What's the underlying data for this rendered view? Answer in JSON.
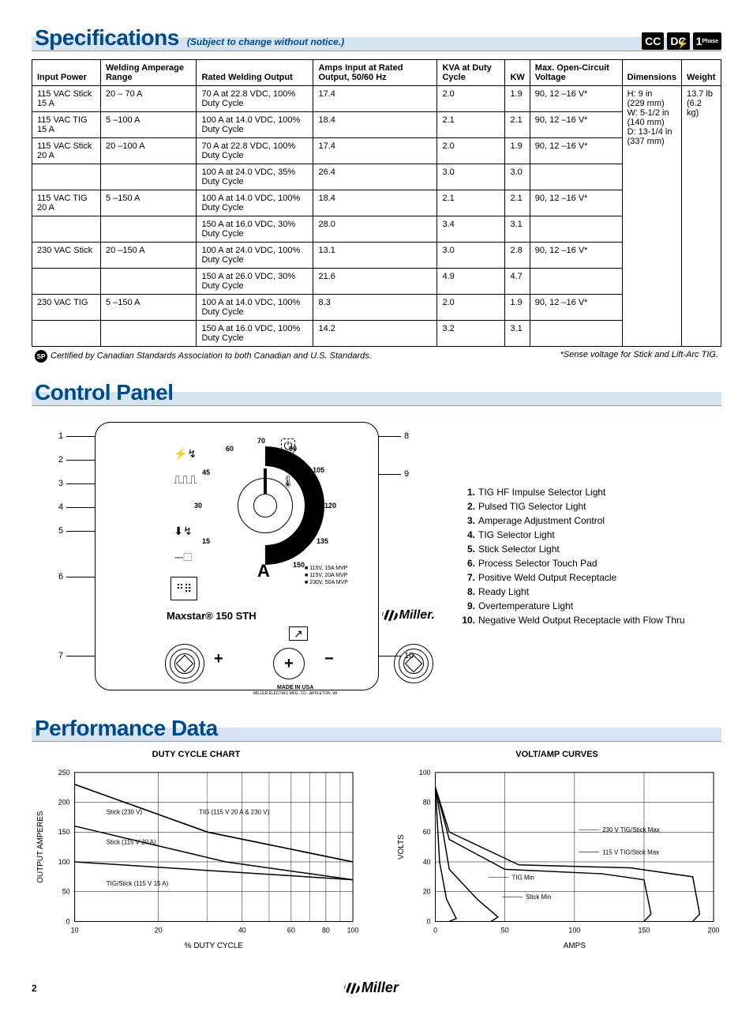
{
  "sections": {
    "specifications": {
      "title": "Specifications",
      "subtitle": "(Subject to change without notice.)"
    },
    "control_panel": {
      "title": "Control Panel"
    },
    "performance": {
      "title": "Performance Data"
    }
  },
  "badges": {
    "cc": "CC",
    "dc": "DC",
    "phase_num": "1",
    "phase_label": "Phase"
  },
  "spec_table": {
    "headers": {
      "input_power": "Input Power",
      "welding_range": "Welding Amperage Range",
      "rated_output": "Rated Welding Output",
      "amps_input": "Amps Input at Rated Output, 50/60 Hz",
      "kva": "KVA at Duty Cycle",
      "kw": "KW",
      "max_ocv": "Max. Open-Circuit Voltage",
      "dimensions": "Dimensions",
      "weight": "Weight"
    },
    "dimensions_text": "H: 9 in\n(229 mm)\nW: 5-1/2 in\n(140 mm)\nD: 13-1/4 in\n(337 mm)",
    "weight_text": "13.7 lb\n(6.2 kg)",
    "rows": [
      {
        "ip": "115 VAC Stick 15 A",
        "wr": "20 – 70 A",
        "ro": "70 A at 22.8 VDC, 100% Duty Cycle",
        "ai": "17.4",
        "kva": "2.0",
        "kw": "1.9",
        "ocv": "90, 12 –16 V*"
      },
      {
        "ip": "115 VAC TIG 15 A",
        "wr": "5 –100 A",
        "ro": "100 A at 14.0 VDC, 100% Duty Cycle",
        "ai": "18.4",
        "kva": "2.1",
        "kw": "2.1",
        "ocv": "90, 12 –16 V*"
      },
      {
        "ip": "115 VAC Stick 20 A",
        "wr": "20 –100 A",
        "ro": "70 A at 22.8 VDC, 100% Duty Cycle",
        "ai": "17.4",
        "kva": "2.0",
        "kw": "1.9",
        "ocv": "90, 12 –16 V*"
      },
      {
        "ip": "",
        "wr": "",
        "ro": "100 A at 24.0 VDC, 35% Duty Cycle",
        "ai": "26.4",
        "kva": "3.0",
        "kw": "3.0",
        "ocv": ""
      },
      {
        "ip": "115 VAC TIG 20 A",
        "wr": "5 –150 A",
        "ro": "100 A at 14.0 VDC, 100% Duty Cycle",
        "ai": "18.4",
        "kva": "2.1",
        "kw": "2.1",
        "ocv": "90, 12 –16 V*"
      },
      {
        "ip": "",
        "wr": "",
        "ro": "150 A at 16.0 VDC, 30% Duty Cycle",
        "ai": "28.0",
        "kva": "3.4",
        "kw": "3.1",
        "ocv": ""
      },
      {
        "ip": "230 VAC Stick",
        "wr": "20 –150 A",
        "ro": "100 A at 24.0 VDC, 100% Duty Cycle",
        "ai": "13.1",
        "kva": "3.0",
        "kw": "2.8",
        "ocv": "90, 12 –16 V*"
      },
      {
        "ip": "",
        "wr": "",
        "ro": "150 A at 26.0 VDC, 30% Duty Cycle",
        "ai": "21.6",
        "kva": "4.9",
        "kw": "4.7",
        "ocv": ""
      },
      {
        "ip": "230 VAC TIG",
        "wr": "5 –150 A",
        "ro": "100 A at 14.0 VDC, 100% Duty Cycle",
        "ai": "8.3",
        "kva": "2.0",
        "kw": "1.9",
        "ocv": "90, 12 –16 V*"
      },
      {
        "ip": "",
        "wr": "",
        "ro": "150 A at 16.0 VDC, 100% Duty Cycle",
        "ai": "14.2",
        "kva": "3.2",
        "kw": "3.1",
        "ocv": ""
      }
    ]
  },
  "cert_note": "Certified by Canadian Standards Association to both Canadian and U.S. Standards.",
  "sense_note": "*Sense voltage for Stick and Lift-Arc TIG.",
  "control_panel": {
    "model": "Maxstar® 150 STH",
    "brand": "Miller.",
    "amp_letter": "A",
    "scale": [
      "15",
      "30",
      "45",
      "60",
      "70",
      "90",
      "105",
      "120",
      "135",
      "150"
    ],
    "mvp": [
      "115V, 15A MVP",
      "115V, 20A MVP",
      "230V, 50A MVP"
    ],
    "made_in": "MADE IN USA",
    "made_sub": "MILLER ELECTRIC MFG. CO., APPLETON, WI",
    "legend": [
      "TIG HF Impulse Selector Light",
      "Pulsed TIG Selector Light",
      "Amperage Adjustment Control",
      "TIG Selector Light",
      "Stick Selector Light",
      "Process Selector Touch Pad",
      "Positive Weld Output Receptacle",
      "Ready Light",
      "Overtemperature Light",
      "Negative Weld Output Receptacle with Flow Thru"
    ]
  },
  "chart_data": [
    {
      "type": "line",
      "title": "DUTY CYCLE CHART",
      "xlabel": "% DUTY CYCLE",
      "ylabel": "OUTPUT AMPERES",
      "xlim": [
        10,
        100
      ],
      "ylim": [
        0,
        250
      ],
      "x_ticks": [
        10,
        20,
        40,
        60,
        80,
        100
      ],
      "y_ticks": [
        0,
        50,
        100,
        150,
        200,
        250
      ],
      "x_scale": "log",
      "series": [
        {
          "name": "Stick (230 V)",
          "data": [
            [
              10,
              230
            ],
            [
              30,
              150
            ],
            [
              100,
              100
            ]
          ]
        },
        {
          "name": "TIG (115 V 20 A & 230 V)",
          "data": [
            [
              10,
              230
            ],
            [
              30,
              150
            ],
            [
              100,
              100
            ]
          ]
        },
        {
          "name": "Stick (115 V 20 A)",
          "data": [
            [
              10,
              160
            ],
            [
              35,
              100
            ],
            [
              100,
              70
            ]
          ]
        },
        {
          "name": "TIG/Stick (115 V 15 A)",
          "data": [
            [
              10,
              100
            ],
            [
              100,
              70
            ]
          ]
        }
      ]
    },
    {
      "type": "line",
      "title": "VOLT/AMP CURVES",
      "xlabel": "AMPS",
      "ylabel": "VOLTS",
      "xlim": [
        0,
        200
      ],
      "ylim": [
        0,
        100
      ],
      "x_ticks": [
        0,
        50,
        100,
        150,
        200
      ],
      "y_ticks": [
        0,
        20,
        40,
        60,
        80,
        100
      ],
      "x_scale": "linear",
      "series": [
        {
          "name": "230 V TIG/Stick Max",
          "data": [
            [
              0,
              90
            ],
            [
              10,
              60
            ],
            [
              60,
              38
            ],
            [
              140,
              36
            ],
            [
              185,
              30
            ],
            [
              190,
              5
            ],
            [
              185,
              0
            ]
          ]
        },
        {
          "name": "115 V TIG/Stick Max",
          "data": [
            [
              0,
              90
            ],
            [
              10,
              55
            ],
            [
              50,
              35
            ],
            [
              120,
              32
            ],
            [
              150,
              28
            ],
            [
              155,
              5
            ],
            [
              150,
              0
            ]
          ]
        },
        {
          "name": "TIG Min",
          "data": [
            [
              0,
              90
            ],
            [
              3,
              40
            ],
            [
              8,
              15
            ],
            [
              15,
              2
            ],
            [
              10,
              0
            ]
          ]
        },
        {
          "name": "Stick Min",
          "data": [
            [
              0,
              90
            ],
            [
              10,
              35
            ],
            [
              30,
              15
            ],
            [
              45,
              3
            ],
            [
              40,
              0
            ]
          ]
        }
      ],
      "annotations": [
        {
          "text": "230 V TIG/Stick Max",
          "x": 120,
          "y": 60
        },
        {
          "text": "115 V TIG/Stick Max",
          "x": 120,
          "y": 45
        },
        {
          "text": "TIG Min",
          "x": 55,
          "y": 28
        },
        {
          "text": "Stick Min",
          "x": 65,
          "y": 15
        }
      ]
    }
  ],
  "page_number": "2",
  "footer_brand": "Miller"
}
